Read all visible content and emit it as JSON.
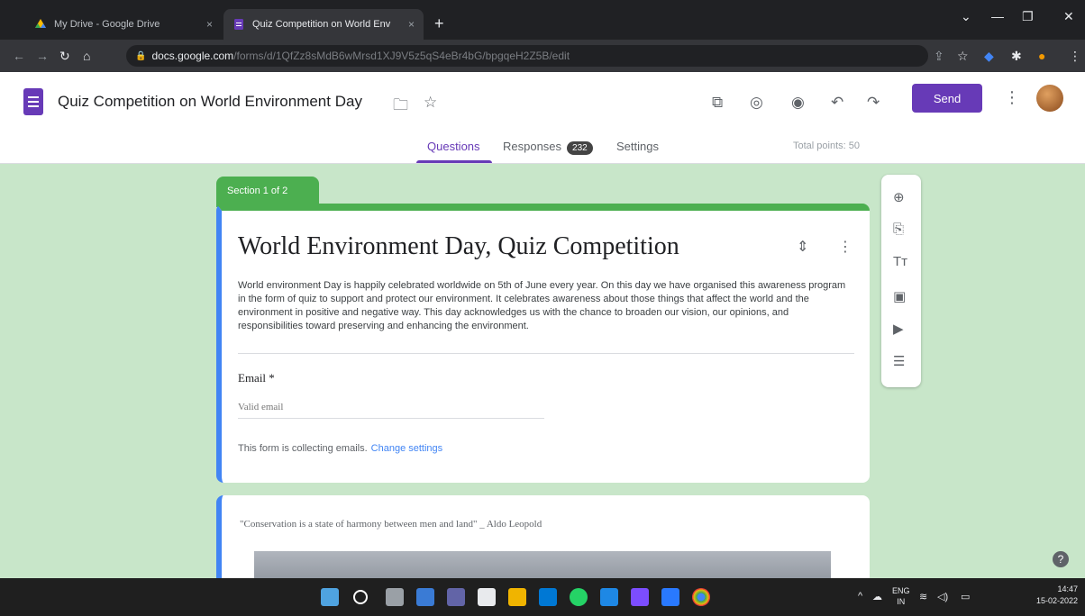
{
  "browser": {
    "tabs": [
      {
        "title": "My Drive - Google Drive",
        "close": "×"
      },
      {
        "title": "Quiz Competition on World Env",
        "close": "×"
      }
    ],
    "new_tab": "+",
    "url_host": "docs.google.com",
    "url_path": "/forms/d/1QfZz8sMdB6wMrsd1XJ9V5z5qS4eBr4bG/bpgqeH2Z5B/edit"
  },
  "header": {
    "title": "Quiz Competition on World Environment Day",
    "send_label": "Send",
    "tabs": {
      "questions": "Questions",
      "responses": "Responses",
      "responses_count": "232",
      "settings": "Settings"
    },
    "total_points": "Total points: 50"
  },
  "form": {
    "section_tag": "Section 1 of 2",
    "title": "World Environment Day, Quiz Competition",
    "description": "World environment Day is happily celebrated worldwide on 5th of June every year. On this day we have organised this awareness program in the form of quiz to support and protect our environment. It celebrates awareness about those things that affect the world and the environment in positive and negative way. This day acknowledges us with the chance to broaden our vision, our opinions, and responsibilities toward preserving and enhancing the environment.",
    "email_label": "Email *",
    "email_placeholder": "Valid email",
    "collect_text": "This form is collecting emails.",
    "change_settings": "Change settings",
    "quote": "\"Conservation is a state of harmony between men and land\"  _ Aldo Leopold"
  },
  "taskbar": {
    "lang_top": "ENG",
    "lang_bottom": "IN",
    "time": "14:47",
    "date": "15-02-2022"
  },
  "colors": {
    "brand": "#673ab7",
    "section_accent": "#4caf50",
    "background": "#c8e6c9"
  }
}
